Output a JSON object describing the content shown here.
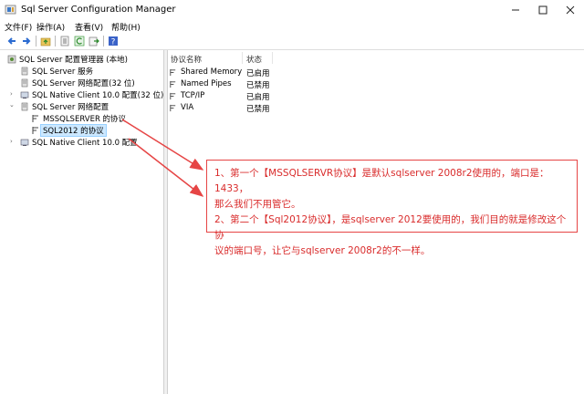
{
  "window": {
    "title": "Sql Server Configuration Manager",
    "buttons": [
      "minimize",
      "maximize",
      "close"
    ]
  },
  "menu": [
    "文件(F)",
    "操作(A)",
    "查看(V)",
    "帮助(H)"
  ],
  "toolbar": {
    "icons": [
      "back-icon",
      "forward-icon",
      "up-folder-icon",
      "properties-icon",
      "refresh-icon",
      "export-icon",
      "help-icon"
    ]
  },
  "tree": {
    "root": "SQL Server 配置管理器 (本地)",
    "items": [
      {
        "label": "SQL Server 服务",
        "icon": "service-icon"
      },
      {
        "label": "SQL Server 网络配置(32 位)",
        "icon": "network-icon"
      },
      {
        "label": "SQL Native Client 10.0 配置(32 位)",
        "icon": "client-icon"
      },
      {
        "label": "SQL Server 网络配置",
        "icon": "network-icon"
      },
      {
        "label": "MSSQLSERVER 的协议",
        "icon": "protocol-icon"
      },
      {
        "label": "SQL2012 的协议",
        "icon": "protocol-icon"
      },
      {
        "label": "SQL Native Client 10.0 配置",
        "icon": "client-icon"
      }
    ]
  },
  "list": {
    "columns": [
      "协议名称",
      "状态"
    ],
    "rows": [
      {
        "name": "Shared Memory",
        "status": "已启用"
      },
      {
        "name": "Named Pipes",
        "status": "已禁用"
      },
      {
        "name": "TCP/IP",
        "status": "已启用"
      },
      {
        "name": "VIA",
        "status": "已禁用"
      }
    ]
  },
  "annotation": {
    "line1": "1、第一个【MSSQLSERVR协议】是默认sqlserver 2008r2使用的，端口是：1433，",
    "line2": "那么我们不用管它。",
    "line3": "2、第二个【Sql2012协议】，是sqlserver 2012要使用的，我们目的就是修改这个协",
    "line4": "议的端口号，让它与sqlserver 2008r2的不一样。",
    "color": "#d92b2b"
  }
}
